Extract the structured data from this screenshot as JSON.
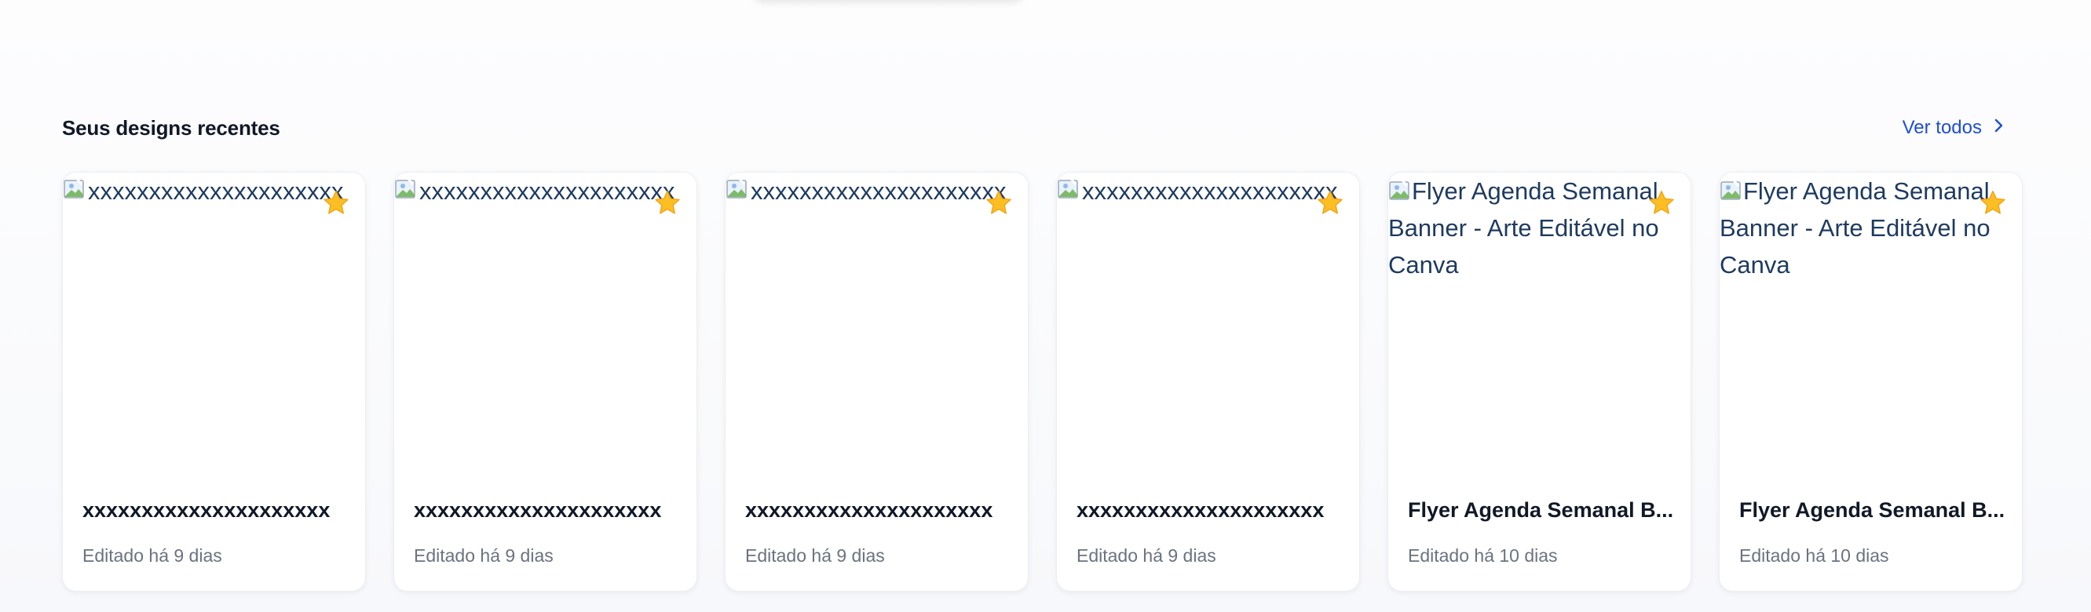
{
  "section": {
    "title": "Seus designs recentes",
    "see_all_label": "Ver todos"
  },
  "colors": {
    "accent": "#1d4ed8",
    "favorite_star": "#fbbf24"
  },
  "icons": {
    "see_all": "chevron-right-icon",
    "favorite": "star-icon",
    "broken_image": "broken-image-icon"
  },
  "cards": [
    {
      "image_alt": "xxxxxxxxxxxxxxxxxxxxx",
      "title": "xxxxxxxxxxxxxxxxxxxxx",
      "subtitle": "Editado há 9 dias"
    },
    {
      "image_alt": "xxxxxxxxxxxxxxxxxxxxx",
      "title": "xxxxxxxxxxxxxxxxxxxxx",
      "subtitle": "Editado há 9 dias"
    },
    {
      "image_alt": "xxxxxxxxxxxxxxxxxxxxx",
      "title": "xxxxxxxxxxxxxxxxxxxxx",
      "subtitle": "Editado há 9 dias"
    },
    {
      "image_alt": "xxxxxxxxxxxxxxxxxxxxx",
      "title": "xxxxxxxxxxxxxxxxxxxxx",
      "subtitle": "Editado há 9 dias"
    },
    {
      "image_alt": "Flyer Agenda Semanal Banner - Arte Editável no Canva",
      "title": "Flyer Agenda Semanal B...",
      "subtitle": "Editado há 10 dias"
    },
    {
      "image_alt": "Flyer Agenda Semanal Banner - Arte Editável no Canva",
      "title": "Flyer Agenda Semanal B...",
      "subtitle": "Editado há 10 dias"
    }
  ]
}
